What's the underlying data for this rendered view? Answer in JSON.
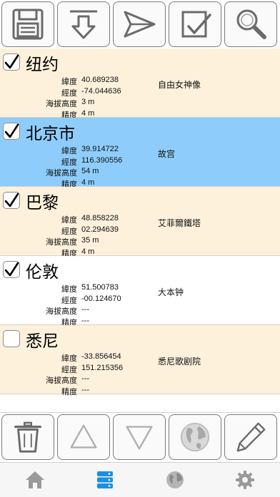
{
  "colors": {
    "row_background": "#fdf1dc",
    "selected_row": "#8ecdfb",
    "plain_row": "#ffffff",
    "active_tab": "#1a8fe6",
    "inactive_tab": "#9a9a9a"
  },
  "toolbar": {
    "buttons": [
      {
        "icon": "save-icon"
      },
      {
        "icon": "download-arrow-icon"
      },
      {
        "icon": "send-icon"
      },
      {
        "icon": "checkbox-icon"
      },
      {
        "icon": "search-icon"
      }
    ]
  },
  "field_labels": {
    "latitude": "緯度",
    "longitude": "經度",
    "altitude": "海拔高度",
    "accuracy": "精度"
  },
  "locations": [
    {
      "name": "纽约",
      "checked": true,
      "selected": false,
      "background": "#fdf1dc",
      "latitude": "40.689238",
      "longitude": "-74.044636",
      "altitude": "3 m",
      "accuracy": "4 m",
      "landmark": "自由女神像"
    },
    {
      "name": "北京市",
      "checked": true,
      "selected": true,
      "background": "#8ecdfb",
      "latitude": "39.914722",
      "longitude": "116.390556",
      "altitude": "54 m",
      "accuracy": "4 m",
      "landmark": "故宫"
    },
    {
      "name": "巴黎",
      "checked": true,
      "selected": false,
      "background": "#fdf1dc",
      "latitude": "48.858228",
      "longitude": "02.294639",
      "altitude": "35 m",
      "accuracy": "4 m",
      "landmark": "艾菲爾鐵塔"
    },
    {
      "name": "伦敦",
      "checked": true,
      "selected": false,
      "background": "#ffffff",
      "latitude": "51.500783",
      "longitude": "-00.124670",
      "altitude": "---",
      "accuracy": "---",
      "landmark": "大本钟"
    },
    {
      "name": "悉尼",
      "checked": false,
      "selected": false,
      "background": "#fdf1dc",
      "latitude": "-33.856454",
      "longitude": "151.215356",
      "altitude": "---",
      "accuracy": "---",
      "landmark": "悉尼歌剧院"
    }
  ],
  "bottom_toolbar": {
    "buttons": [
      {
        "icon": "trash-icon"
      },
      {
        "icon": "triangle-up-icon"
      },
      {
        "icon": "triangle-down-icon"
      },
      {
        "icon": "globe-icon"
      },
      {
        "icon": "pencil-icon"
      }
    ]
  },
  "tabs": [
    {
      "icon": "home-icon",
      "active": false
    },
    {
      "icon": "server-list-icon",
      "active": true
    },
    {
      "icon": "globe-icon",
      "active": false
    },
    {
      "icon": "gear-icon",
      "active": false
    }
  ]
}
